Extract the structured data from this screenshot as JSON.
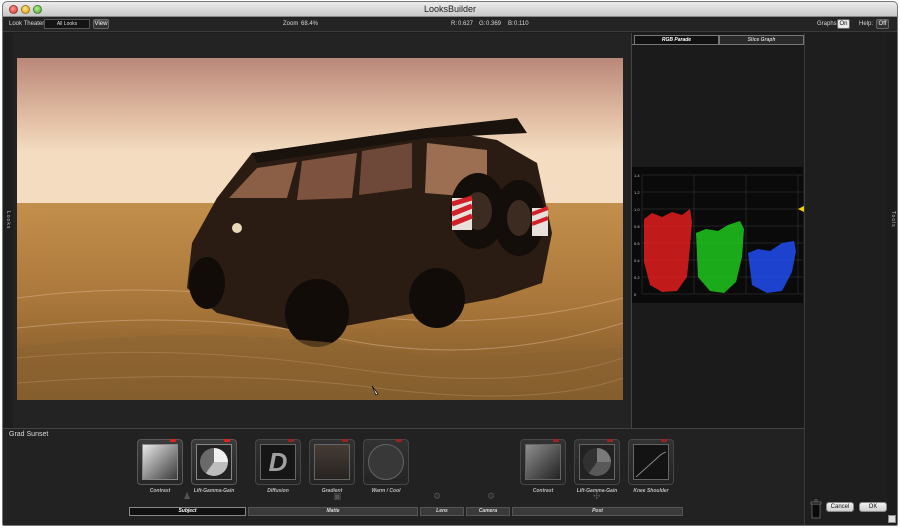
{
  "app": {
    "title": "LooksBuilder"
  },
  "toolbar": {
    "look_theater_label": "Look Theater:",
    "look_theater_value": "All Looks",
    "view_button": "View",
    "zoom_label": "Zoom",
    "zoom_value": "68.4%",
    "r_label": "R:",
    "r_value": "0.627",
    "g_label": "G:",
    "g_value": "0.369",
    "b_label": "B:",
    "b_value": "0.110",
    "graphs_label": "Graphs:",
    "graphs_value": "On",
    "help_label": "Help:",
    "help_value": "Off"
  },
  "side_tabs": {
    "left": "Looks",
    "right": "Tools"
  },
  "scopes": {
    "tabs": [
      {
        "label": "RGB Parade",
        "active": true
      },
      {
        "label": "Slice Graph",
        "active": false
      }
    ],
    "y_ticks": [
      "1.4",
      "1.2",
      "1.0",
      "0.8",
      "0.6",
      "0.4",
      "0.2",
      "0"
    ],
    "colors": {
      "red": "#ff2020",
      "green": "#20e020",
      "blue": "#2050ff",
      "marker": "#f2d000"
    }
  },
  "look_name": "Grad Sunset",
  "tools": [
    {
      "label": "Contrast",
      "icon": "contrast-gradient-icon",
      "dim": false
    },
    {
      "label": "Lift-Gamma-Gain",
      "icon": "lift-gamma-gain-icon",
      "dim": false
    },
    {
      "label": "Diffusion",
      "icon": "diffusion-icon",
      "dim": true
    },
    {
      "label": "Gradient",
      "icon": "gradient-icon",
      "dim": true
    },
    {
      "label": "Warm / Cool",
      "icon": "warm-cool-icon",
      "dim": true
    },
    {
      "label": "Contrast",
      "icon": "contrast-gradient-icon",
      "dim": true
    },
    {
      "label": "Lift-Gamma-Gain",
      "icon": "lift-gamma-gain-icon",
      "dim": true
    },
    {
      "label": "Knee Shoulder",
      "icon": "knee-shoulder-icon",
      "dim": true
    }
  ],
  "categories": [
    {
      "label": "Subject",
      "active": true
    },
    {
      "label": "Matte",
      "active": false
    },
    {
      "label": "Lens",
      "active": false
    },
    {
      "label": "Camera",
      "active": false
    },
    {
      "label": "Post",
      "active": false
    }
  ],
  "actions": {
    "cancel": "Cancel",
    "ok": "OK"
  }
}
